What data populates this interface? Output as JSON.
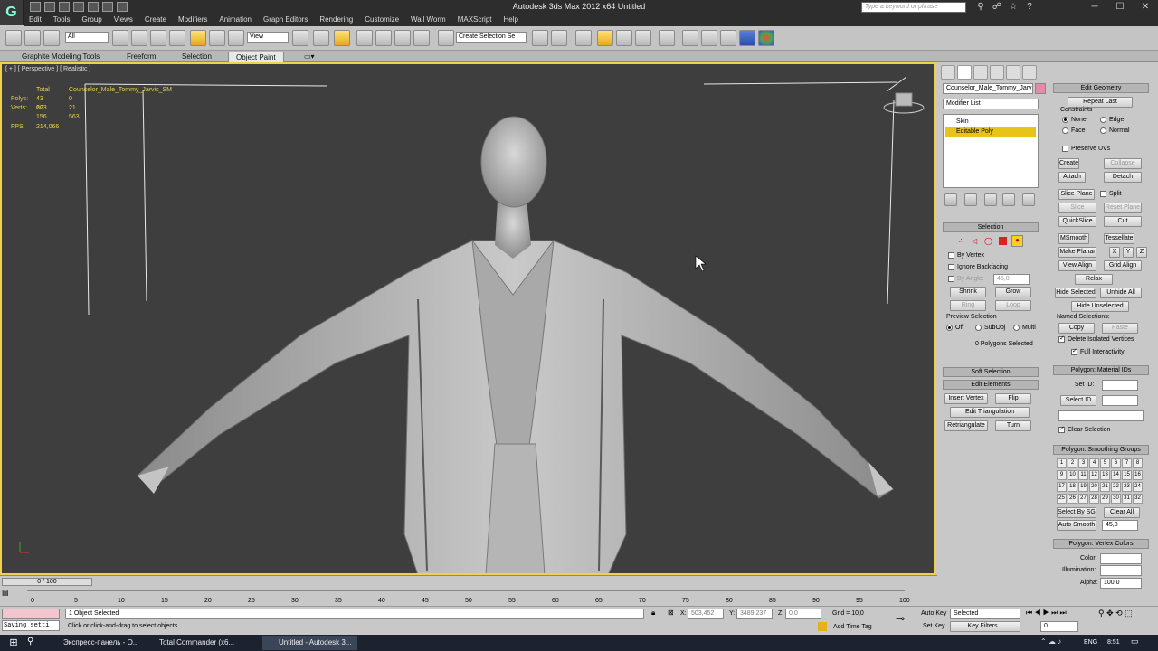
{
  "app": {
    "title": "Autodesk 3ds Max  2012 x64     Untitled",
    "search_placeholder": "Type a keyword or phrase",
    "logo": "G"
  },
  "menu": [
    "Edit",
    "Tools",
    "Group",
    "Views",
    "Create",
    "Modifiers",
    "Animation",
    "Graph Editors",
    "Rendering",
    "Customize",
    "Wall Worm",
    "MAXScript",
    "Help"
  ],
  "toolbar": {
    "selection_filter": "All",
    "ref_coord": "View",
    "named_selection": "Create Selection Se"
  },
  "ribbon": {
    "tabs": [
      "Graphite Modeling Tools",
      "Freeform",
      "Selection",
      "Object Paint"
    ],
    "active_tab": "Object Paint"
  },
  "viewport": {
    "label": "[ + ] [ Perspective ] [ Realistic ]",
    "stats": {
      "total_label": "Total",
      "object_name": "Counselor_Male_Tommy_Jarvis_SM",
      "polys_label": "Polys:",
      "polys_total": "43 603",
      "polys_selected": "0",
      "verts_label": "Verts:",
      "verts_total": "22 156",
      "verts_selected": "21 563",
      "fps_label": "FPS:",
      "fps": "214,066"
    },
    "cursor_icon": "mouse-pointer-icon"
  },
  "command_panel": {
    "object_name": "Counselor_Male_Tommy_Jarv",
    "modifier_list": "Modifier List",
    "modifiers": [
      "Skin",
      "Editable Poly"
    ],
    "selected_modifier": "Editable Poly",
    "selection": {
      "header": "Selection",
      "by_vertex": "By Vertex",
      "ignore_backfacing": "Ignore Backfacing",
      "by_angle": "By Angle:",
      "by_angle_value": "45,0",
      "shrink": "Shrink",
      "grow": "Grow",
      "ring": "Ring",
      "loop": "Loop",
      "preview_label": "Preview Selection",
      "preview_off": "Off",
      "preview_subobj": "SubObj",
      "preview_multi": "Multi",
      "status": "0 Polygons Selected"
    },
    "soft_selection": "Soft Selection",
    "edit_elements": {
      "header": "Edit Elements",
      "insert_vertex": "Insert Vertex",
      "flip": "Flip",
      "edit_triangulation": "Edit Triangulation",
      "retriangulate": "Retriangulate",
      "turn": "Turn"
    },
    "edit_geometry": {
      "header": "Edit Geometry",
      "repeat_last": "Repeat Last",
      "constraints": "Constraints",
      "none": "None",
      "edge": "Edge",
      "face": "Face",
      "normal": "Normal",
      "preserve_uvs": "Preserve UVs",
      "create": "Create",
      "collapse": "Collapse",
      "attach": "Attach",
      "detach": "Detach",
      "slice_plane": "Slice Plane",
      "split": "Split",
      "slice": "Slice",
      "reset_plane": "Reset Plane",
      "quickslice": "QuickSlice",
      "cut": "Cut",
      "msmooth": "MSmooth",
      "tessellate": "Tessellate",
      "make_planar": "Make Planar",
      "x": "X",
      "y": "Y",
      "z": "Z",
      "view_align": "View Align",
      "grid_align": "Grid Align",
      "relax": "Relax",
      "hide_selected": "Hide Selected",
      "unhide_all": "Unhide All",
      "hide_unselected": "Hide Unselected",
      "named_selections": "Named Selections:",
      "copy": "Copy",
      "paste": "Paste",
      "delete_isolated": "Delete Isolated Vertices",
      "full_interactivity": "Full Interactivity"
    },
    "material_ids": {
      "header": "Polygon: Material IDs",
      "set_id": "Set ID:",
      "select_id": "Select ID",
      "clear_selection": "Clear Selection"
    },
    "smoothing_groups": {
      "header": "Polygon: Smoothing Groups",
      "groups": [
        "1",
        "2",
        "3",
        "4",
        "5",
        "6",
        "7",
        "8",
        "9",
        "10",
        "11",
        "12",
        "13",
        "14",
        "15",
        "16",
        "17",
        "18",
        "19",
        "20",
        "21",
        "22",
        "23",
        "24",
        "25",
        "26",
        "27",
        "28",
        "29",
        "30",
        "31",
        "32"
      ],
      "select_by_sg": "Select By SG",
      "clear_all": "Clear All",
      "auto_smooth": "Auto Smooth",
      "auto_smooth_value": "45,0"
    },
    "vertex_colors": {
      "header": "Polygon: Vertex Colors",
      "color": "Color:",
      "illumination": "Illumination:",
      "alpha": "Alpha:",
      "alpha_value": "100,0"
    }
  },
  "timeline": {
    "frame": "0 / 100",
    "ticks": [
      "0",
      "5",
      "10",
      "15",
      "20",
      "25",
      "30",
      "35",
      "40",
      "45",
      "50",
      "55",
      "60",
      "65",
      "70",
      "75",
      "80",
      "85",
      "90",
      "95",
      "100"
    ]
  },
  "status": {
    "listener": "Saving setti",
    "selected": "1 Object Selected",
    "prompt": "Click or click-and-drag to select objects",
    "x_label": "X:",
    "x_value": "503,452",
    "y_label": "Y:",
    "y_value": "3489,237",
    "z_label": "Z:",
    "z_value": "0,0",
    "grid": "Grid = 10,0",
    "add_time_tag": "Add Time Tag",
    "auto_key": "Auto Key",
    "set_key": "Set Key",
    "key_mode": "Selected",
    "key_filters": "Key Filters...",
    "frame_value": "0"
  },
  "taskbar": {
    "tasks": [
      "Экспресс-панель - O...",
      "Total Commander (x6...",
      "",
      "Untitled - Autodesk 3..."
    ],
    "lang": "ENG",
    "time": "8:51"
  }
}
